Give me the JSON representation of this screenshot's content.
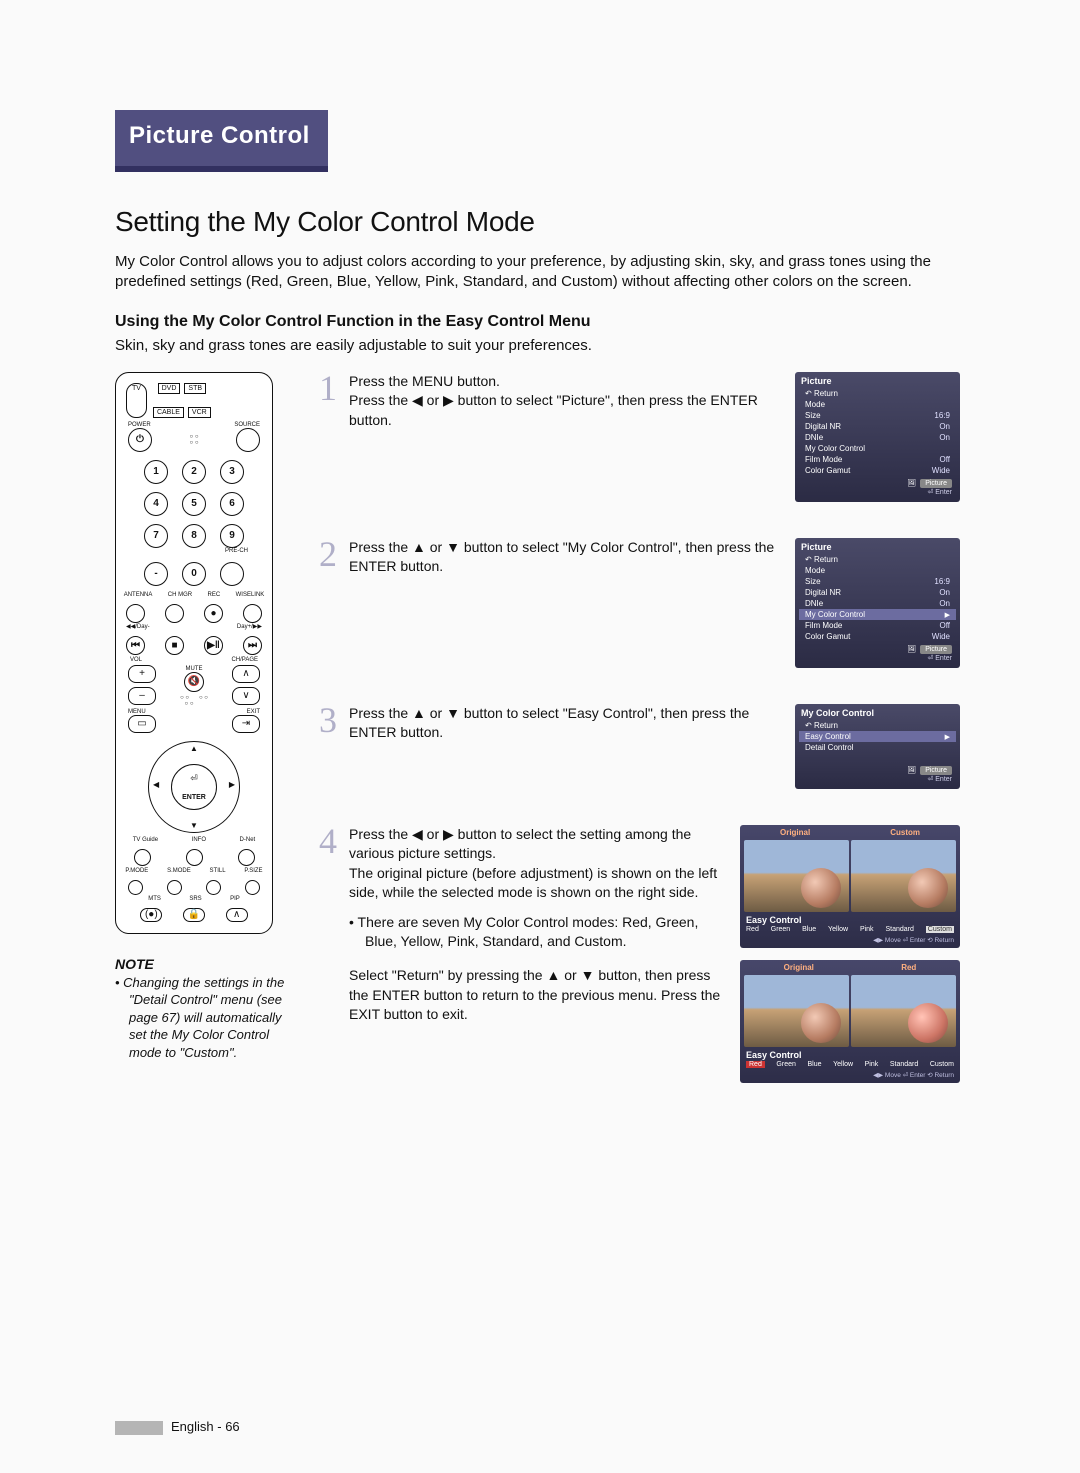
{
  "header": {
    "tab": "Picture Control"
  },
  "section": {
    "title": "Setting the My Color Control Mode",
    "intro": "My Color Control allows you to adjust colors according to your preference, by adjusting skin, sky, and grass tones using the predefined settings (Red, Green, Blue, Yellow, Pink, Standard, and Custom) without affecting other colors on the screen.",
    "subhead": "Using the My Color Control Function in the Easy Control Menu",
    "lead": "Skin, sky and grass tones are easily adjustable to suit your preferences."
  },
  "remote": {
    "src_tv": "TV",
    "src_dvd": "DVD",
    "src_stb": "STB",
    "src_cable": "CABLE",
    "src_vcr": "VCR",
    "power": "POWER",
    "source": "SOURCE",
    "nums": [
      "1",
      "2",
      "3",
      "4",
      "5",
      "6",
      "7",
      "8",
      "9",
      "-",
      "0"
    ],
    "pre_ch": "PRE-CH",
    "antenna": "ANTENNA",
    "chmgr": "CH MGR",
    "rec": "REC",
    "wiselink": "WISELINK",
    "day_minus": "◀◀/Day-",
    "day_plus": "Day+/▶▶",
    "vol": "VOL",
    "mute": "MUTE",
    "chpage": "CH/PAGE",
    "menu": "MENU",
    "exit": "EXIT",
    "enter": "ENTER",
    "tvguide": "TV Guide",
    "info": "INFO",
    "dnet": "D-Net",
    "pmode": "P.MODE",
    "smode": "S.MODE",
    "still": "STILL",
    "psize": "P.SIZE",
    "mts": "MTS",
    "srs": "SRS",
    "pip": "PIP"
  },
  "note": {
    "head": "NOTE",
    "body": "Changing the settings in the \"Detail Control\" menu (see page 67) will automatically set the My Color Control mode to \"Custom\"."
  },
  "steps": {
    "s1": {
      "num": "1",
      "text": "Press the MENU button.\nPress the ◀ or ▶ button to select \"Picture\", then press the ENTER button."
    },
    "s2": {
      "num": "2",
      "text": "Press the ▲ or ▼ button to select \"My Color Control\", then press the ENTER button."
    },
    "s3": {
      "num": "3",
      "text": "Press the ▲ or ▼ button to select \"Easy Control\", then press the ENTER button."
    },
    "s4": {
      "num": "4",
      "text_a": "Press the ◀ or ▶ button to select the setting among the various picture settings.\nThe original picture (before adjustment) is shown on the left side, while the selected mode is shown on the right side.",
      "bullet": "There are seven My Color Control modes: Red, Green, Blue, Yellow, Pink, Standard, and Custom.",
      "text_b": "Select \"Return\" by pressing the ▲ or ▼ button, then press the ENTER button to return to the previous menu. Press the EXIT button to exit."
    }
  },
  "osd1": {
    "title": "Picture",
    "return": "Return",
    "rows": [
      {
        "k": "Mode",
        "v": ""
      },
      {
        "k": "Size",
        "v": "16:9"
      },
      {
        "k": "Digital NR",
        "v": "On"
      },
      {
        "k": "DNIe",
        "v": "On"
      },
      {
        "k": "My Color Control",
        "v": ""
      },
      {
        "k": "Film Mode",
        "v": "Off"
      },
      {
        "k": "Color Gamut",
        "v": "Wide"
      }
    ],
    "picture_label": "Picture",
    "enter": "Enter"
  },
  "osd2": {
    "title": "Picture",
    "return": "Return",
    "rows_top": [
      {
        "k": "Mode",
        "v": ""
      },
      {
        "k": "Size",
        "v": "16:9"
      },
      {
        "k": "Digital NR",
        "v": "On"
      },
      {
        "k": "DNIe",
        "v": "On"
      }
    ],
    "hl": "My Color Control",
    "rows_bot": [
      {
        "k": "Film Mode",
        "v": "Off"
      },
      {
        "k": "Color Gamut",
        "v": "Wide"
      }
    ],
    "picture_label": "Picture",
    "enter": "Enter"
  },
  "osd3": {
    "title": "My Color Control",
    "return": "Return",
    "hl": "Easy Control",
    "rows": [
      {
        "k": "Detail Control",
        "v": ""
      }
    ],
    "picture_label": "Picture",
    "enter": "Enter"
  },
  "preview1": {
    "left_label": "Original",
    "right_label": "Custom",
    "ec": "Easy Control",
    "modes": [
      "Red",
      "Green",
      "Blue",
      "Yellow",
      "Pink",
      "Standard",
      "Custom"
    ],
    "selected": "Custom",
    "foot": "◀▶ Move   ⏎ Enter   ⟲ Return"
  },
  "preview2": {
    "left_label": "Original",
    "right_label": "Red",
    "ec": "Easy Control",
    "modes": [
      "Red",
      "Green",
      "Blue",
      "Yellow",
      "Pink",
      "Standard",
      "Custom"
    ],
    "selected": "Red",
    "foot": "◀▶ Move   ⏎ Enter   ⟲ Return"
  },
  "footer": {
    "text": "English - 66"
  }
}
